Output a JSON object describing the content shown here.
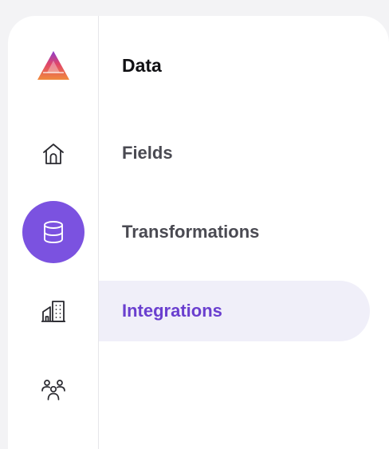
{
  "rail": {
    "items": [
      {
        "id": "logo",
        "icon": "logo-icon"
      },
      {
        "id": "home",
        "icon": "home-icon"
      },
      {
        "id": "data",
        "icon": "database-icon",
        "active": true
      },
      {
        "id": "org",
        "icon": "building-icon"
      },
      {
        "id": "users",
        "icon": "users-icon"
      }
    ]
  },
  "panel": {
    "title": "Data",
    "items": [
      {
        "label": "Fields",
        "active": false
      },
      {
        "label": "Transformations",
        "active": false
      },
      {
        "label": "Integrations",
        "active": true
      }
    ]
  },
  "colors": {
    "accent": "#7b52e0",
    "active_text": "#6a3fcf",
    "active_bg": "#f0eff9",
    "text": "#4a4a52",
    "page_bg": "#f3f3f5"
  }
}
